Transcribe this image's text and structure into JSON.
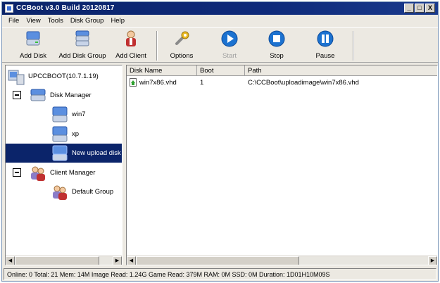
{
  "window": {
    "title": "CCBoot v3.0 Build 20120817",
    "controls": [
      "_",
      "□",
      "X"
    ]
  },
  "menu": [
    "File",
    "View",
    "Tools",
    "Disk Group",
    "Help"
  ],
  "toolbar": {
    "add_disk": "Add Disk",
    "add_disk_group": "Add Disk Group",
    "add_client": "Add Client",
    "options": "Options",
    "start": "Start",
    "stop": "Stop",
    "pause": "Pause"
  },
  "tree": {
    "root": "UPCCBOOT(10.7.1.19)",
    "disk_manager": "Disk Manager",
    "disks": [
      "win7",
      "xp",
      "New upload disk"
    ],
    "client_manager": "Client Manager",
    "groups": [
      "Default Group"
    ]
  },
  "list": {
    "columns": [
      "Disk Name",
      "Boot",
      "Path"
    ],
    "rows": [
      {
        "name": "win7x86.vhd",
        "boot": "1",
        "path": "C:\\CCBoot\\uploadimage\\win7x86.vhd"
      }
    ]
  },
  "status": "Online: 0 Total: 21 Mem: 14M Image Read: 1.24G Game Read: 379M RAM: 0M SSD: 0M Duration: 1D01H10M09S"
}
